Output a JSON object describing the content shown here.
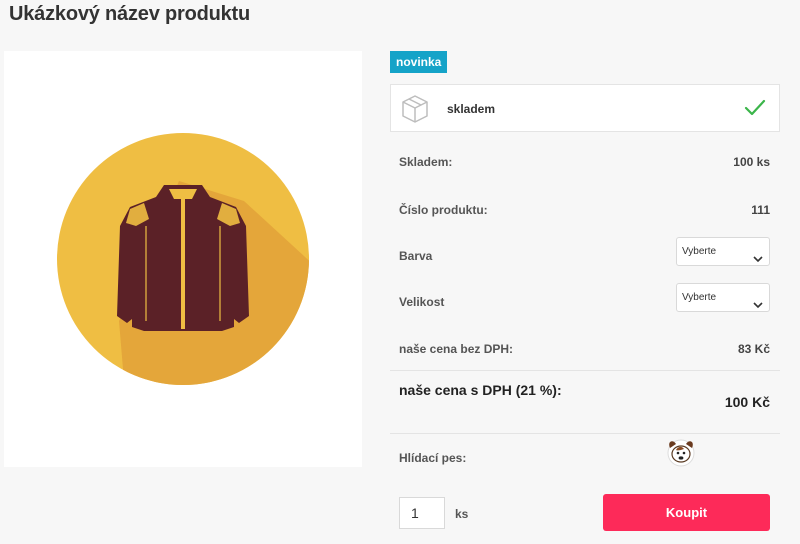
{
  "product": {
    "title": "Ukázkový název produktu",
    "flag": "novinka",
    "availability": "skladem"
  },
  "details": {
    "stock_label": "Skladem:",
    "stock_value": "100 ks",
    "code_label": "Číslo produktu:",
    "code_value": "111",
    "color_label": "Barva",
    "color_select": "Vyberte",
    "size_label": "Velikost",
    "size_select": "Vyberte",
    "price_no_vat_label": "naše cena bez DPH:",
    "price_no_vat_value": "83 Kč",
    "price_vat_label": "naše cena s DPH (21 %):",
    "price_vat_value": "100 Kč",
    "watchdog_label": "Hlídací pes:"
  },
  "cart": {
    "quantity": "1",
    "unit": "ks",
    "buy_label": "Koupit"
  },
  "colors": {
    "flag_bg": "#15a3c8",
    "buy_bg": "#fd2a59",
    "check": "#3bb54a",
    "circle": "#efbe43",
    "jacket": "#5b2127"
  },
  "icons": [
    "box-icon",
    "check-icon",
    "chevron-down-icon",
    "watchdog-icon",
    "jacket-image"
  ]
}
